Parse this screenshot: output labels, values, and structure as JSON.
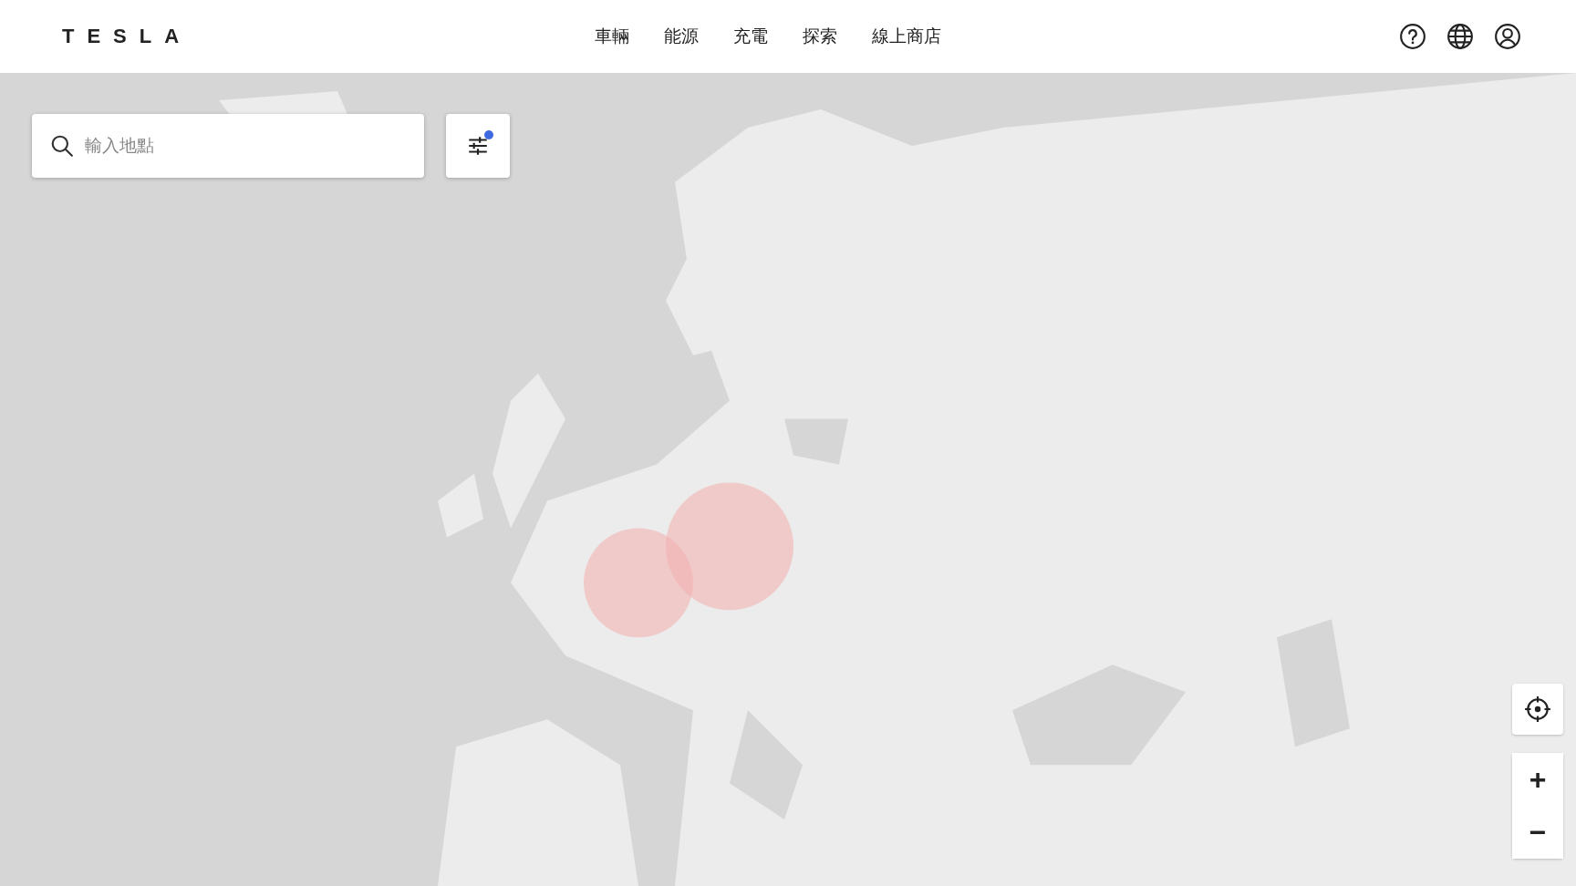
{
  "header": {
    "brand": "TESLA",
    "nav": [
      {
        "label": "車輛"
      },
      {
        "label": "能源"
      },
      {
        "label": "充電"
      },
      {
        "label": "探索"
      },
      {
        "label": "線上商店"
      }
    ]
  },
  "search": {
    "placeholder": "輸入地點"
  },
  "filter": {
    "active": true
  },
  "map_controls": {
    "zoom_in": "+",
    "zoom_out": "−"
  }
}
